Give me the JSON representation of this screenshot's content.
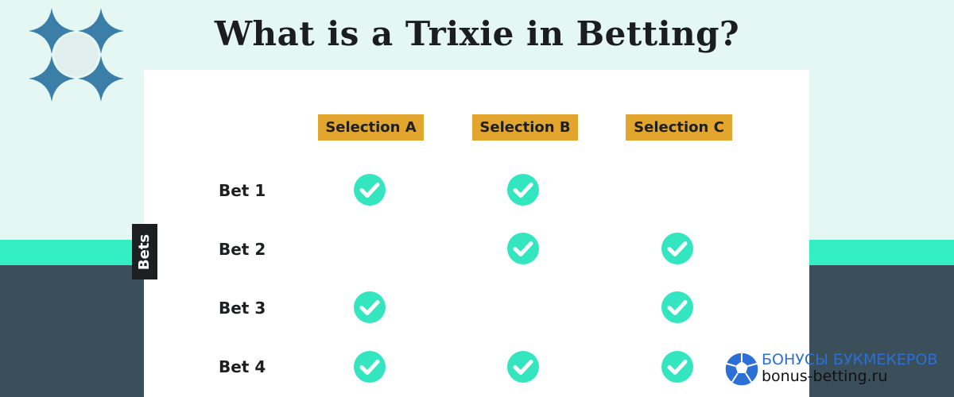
{
  "header": {
    "title": "What is a Trixie in Betting?"
  },
  "axis": {
    "rows_label": "Bets"
  },
  "selections": [
    "Selection A",
    "Selection B",
    "Selection C"
  ],
  "bets": [
    {
      "label": "Bet 1",
      "selections": [
        true,
        true,
        false
      ]
    },
    {
      "label": "Bet 2",
      "selections": [
        false,
        true,
        true
      ]
    },
    {
      "label": "Bet 3",
      "selections": [
        true,
        false,
        true
      ]
    },
    {
      "label": "Bet 4",
      "selections": [
        true,
        true,
        true
      ]
    }
  ],
  "watermark": {
    "line1": "БОНУСЫ БУКМЕКЕРОВ",
    "line2": "bonus-betting.ru"
  },
  "colors": {
    "header_bg": "#e2a52e",
    "check": "#33e6c0",
    "background_light": "#e4f7f3",
    "stripe": "#33efc3",
    "background_dark": "#3b4f5a",
    "logo": "#3b7fa8"
  },
  "icons": {
    "logo": "four-point-star-cluster-icon",
    "check": "check-circle-icon",
    "watermark": "soccer-ball-icon"
  }
}
